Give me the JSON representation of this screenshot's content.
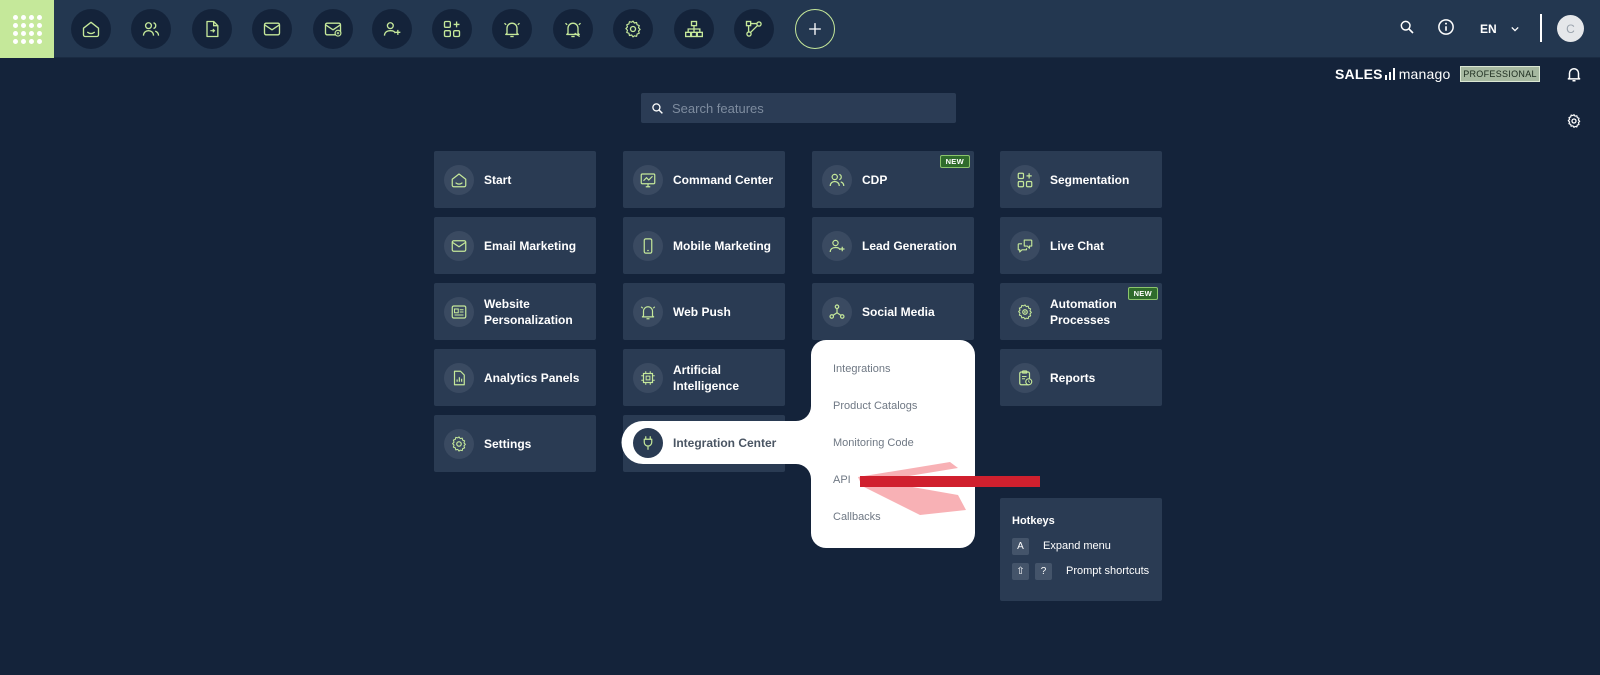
{
  "topbar": {
    "nav_icons": [
      "home-icon",
      "users-icon",
      "file-transfer-icon",
      "mail-icon",
      "mail-plus-icon",
      "user-plus-icon",
      "apps-plus-icon",
      "bell-icon",
      "bell-settings-icon",
      "gear-icon",
      "sitemap-icon",
      "workflow-icon",
      "plus-icon"
    ],
    "language": "EN",
    "avatar_initial": "C"
  },
  "brand": {
    "name_bold": "SALES",
    "name_light": "manago",
    "plan": "PROFESSIONAL"
  },
  "search": {
    "placeholder": "Search features"
  },
  "tiles": [
    {
      "label": "Start",
      "icon": "home-icon"
    },
    {
      "label": "Command Center",
      "icon": "monitor-chart-icon"
    },
    {
      "label": "CDP",
      "icon": "users-icon",
      "badge": "NEW"
    },
    {
      "label": "Segmentation",
      "icon": "apps-plus-icon"
    },
    {
      "label": "Email Marketing",
      "icon": "mail-icon"
    },
    {
      "label": "Mobile Marketing",
      "icon": "phone-icon"
    },
    {
      "label": "Lead Generation",
      "icon": "user-plus-icon"
    },
    {
      "label": "Live Chat",
      "icon": "chat-icon"
    },
    {
      "label": "Website Personalization",
      "icon": "id-card-icon"
    },
    {
      "label": "Web Push",
      "icon": "bell-icon"
    },
    {
      "label": "Social Media",
      "icon": "share-nodes-icon"
    },
    {
      "label": "Automation Processes",
      "icon": "gear-play-icon",
      "badge": "NEW"
    },
    {
      "label": "Analytics Panels",
      "icon": "file-chart-icon"
    },
    {
      "label": "Artificial Intelligence",
      "icon": "chip-icon"
    },
    {
      "label": "Reports",
      "icon": "clipboard-clock-icon"
    },
    {
      "label": "Settings",
      "icon": "gear-icon"
    }
  ],
  "integration": {
    "label": "Integration Center",
    "icon": "plug-icon",
    "submenu": [
      "Integrations",
      "Product Catalogs",
      "Monitoring Code",
      "API",
      "Callbacks"
    ]
  },
  "hotkeys": {
    "title": "Hotkeys",
    "items": [
      {
        "keys": [
          "A"
        ],
        "label": "Expand menu"
      },
      {
        "keys": [
          "⇧",
          "?"
        ],
        "label": "Prompt shortcuts"
      }
    ]
  },
  "colors": {
    "background": "#14233a",
    "topbar": "#233750",
    "tile": "#2a3b53",
    "accent": "#c5e89a",
    "annotation": "#d0202e"
  }
}
